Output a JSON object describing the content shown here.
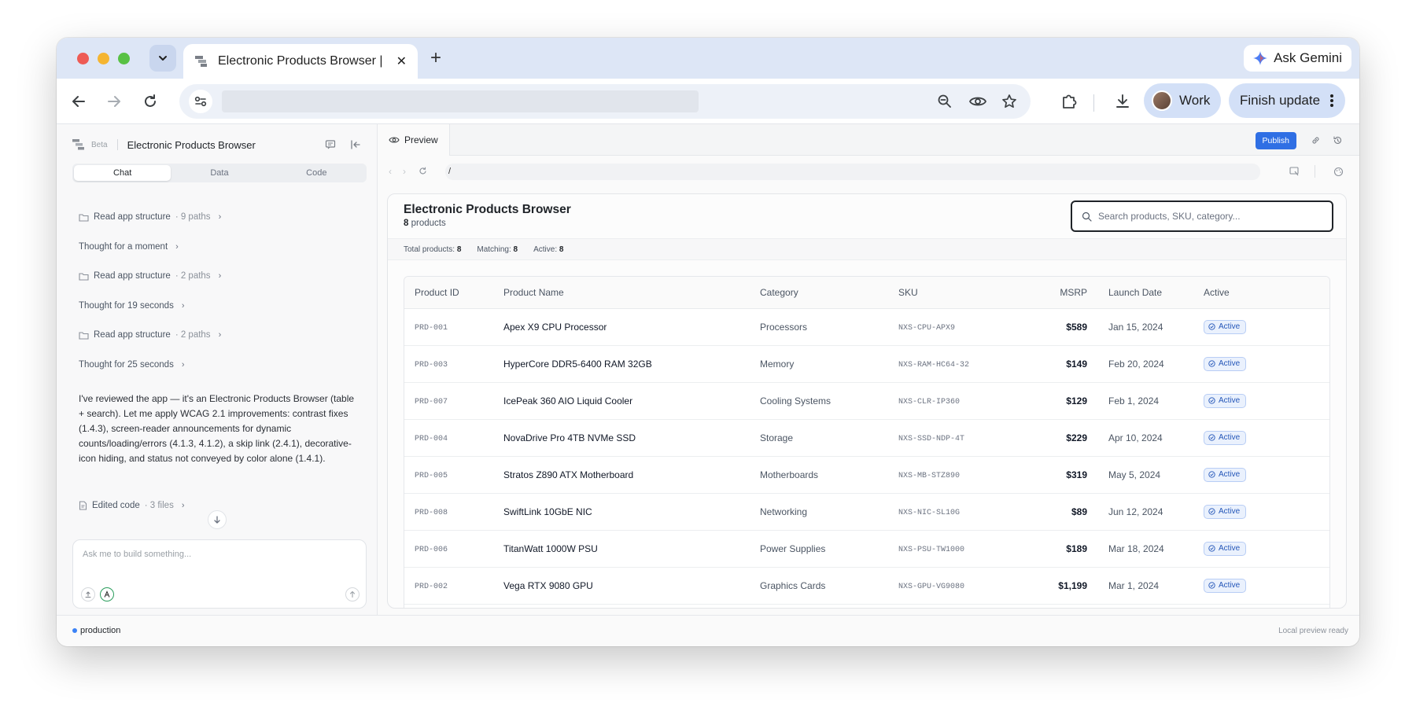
{
  "browser": {
    "tab_title": "Electronic Products Browser |",
    "tab_close": "✕",
    "new_tab": "+",
    "gemini_label": "Ask Gemini",
    "profile_label": "Work",
    "finish_update_label": "Finish update"
  },
  "left_panel": {
    "beta": "Beta",
    "title": "Electronic Products Browser",
    "tabs": [
      "Chat",
      "Data",
      "Code"
    ],
    "activity": [
      {
        "label": "Read app structure",
        "detail": "· 9 paths",
        "type": "folder"
      },
      {
        "label": "Thought for a moment",
        "detail": "",
        "type": "thought"
      },
      {
        "label": "Read app structure",
        "detail": "· 2 paths",
        "type": "folder"
      },
      {
        "label": "Thought for 19 seconds",
        "detail": "",
        "type": "thought"
      },
      {
        "label": "Read app structure",
        "detail": "· 2 paths",
        "type": "folder"
      },
      {
        "label": "Thought for 25 seconds",
        "detail": "",
        "type": "thought"
      }
    ],
    "message": "I've reviewed the app — it's an Electronic Products Browser (table + search). Let me apply WCAG 2.1 improvements: contrast fixes (1.4.3), screen-reader announcements for dynamic counts/loading/errors (4.1.3, 4.1.2), a skip link (2.4.1), decorative-icon hiding, and status not conveyed by color alone (1.4.1).",
    "edited": {
      "label": "Edited code",
      "detail": "· 3 files"
    },
    "composer_placeholder": "Ask me to build something..."
  },
  "preview": {
    "tab_label": "Preview",
    "publish_label": "Publish",
    "path": "/",
    "app": {
      "title": "Electronic Products Browser",
      "count": "8",
      "count_suffix": "products",
      "search_placeholder": "Search products, SKU, category...",
      "stats": {
        "total_label": "Total products:",
        "total": "8",
        "matching_label": "Matching:",
        "matching": "8",
        "active_label": "Active:",
        "active": "8"
      },
      "columns": [
        "Product ID",
        "Product Name",
        "Category",
        "SKU",
        "MSRP",
        "Launch Date",
        "Active"
      ],
      "rows": [
        {
          "id": "PRD-001",
          "name": "Apex X9 CPU Processor",
          "category": "Processors",
          "sku": "NXS-CPU-APX9",
          "msrp": "$589",
          "date": "Jan 15, 2024",
          "status": "Active"
        },
        {
          "id": "PRD-003",
          "name": "HyperCore DDR5-6400 RAM 32GB",
          "category": "Memory",
          "sku": "NXS-RAM-HC64-32",
          "msrp": "$149",
          "date": "Feb 20, 2024",
          "status": "Active"
        },
        {
          "id": "PRD-007",
          "name": "IcePeak 360 AIO Liquid Cooler",
          "category": "Cooling Systems",
          "sku": "NXS-CLR-IP360",
          "msrp": "$129",
          "date": "Feb 1, 2024",
          "status": "Active"
        },
        {
          "id": "PRD-004",
          "name": "NovaDrive Pro 4TB NVMe SSD",
          "category": "Storage",
          "sku": "NXS-SSD-NDP-4T",
          "msrp": "$229",
          "date": "Apr 10, 2024",
          "status": "Active"
        },
        {
          "id": "PRD-005",
          "name": "Stratos Z890 ATX Motherboard",
          "category": "Motherboards",
          "sku": "NXS-MB-STZ890",
          "msrp": "$319",
          "date": "May 5, 2024",
          "status": "Active"
        },
        {
          "id": "PRD-008",
          "name": "SwiftLink 10GbE NIC",
          "category": "Networking",
          "sku": "NXS-NIC-SL10G",
          "msrp": "$89",
          "date": "Jun 12, 2024",
          "status": "Active"
        },
        {
          "id": "PRD-006",
          "name": "TitanWatt 1000W PSU",
          "category": "Power Supplies",
          "sku": "NXS-PSU-TW1000",
          "msrp": "$189",
          "date": "Mar 18, 2024",
          "status": "Active"
        },
        {
          "id": "PRD-002",
          "name": "Vega RTX 9080 GPU",
          "category": "Graphics Cards",
          "sku": "NXS-GPU-VG9080",
          "msrp": "$1,199",
          "date": "Mar 1, 2024",
          "status": "Active"
        }
      ]
    }
  },
  "statusbar": {
    "environment": "production",
    "ready": "Local preview ready"
  },
  "colors": {
    "accent": "#2f6fe4",
    "tabstrip": "#dde6f6",
    "badge_bg": "#eaf1fd",
    "badge_text": "#2456b8"
  },
  "icons": [
    "chevron-down-icon",
    "tab-favicon-icon",
    "close-icon",
    "plus-icon",
    "gemini-sparkle-icon",
    "back-arrow-icon",
    "forward-arrow-icon",
    "reload-icon",
    "site-settings-icon",
    "zoom-out-icon",
    "eye-icon",
    "star-icon",
    "extensions-icon",
    "download-icon",
    "more-vert-icon",
    "folder-icon",
    "file-icon",
    "search-icon",
    "check-circle-icon"
  ]
}
